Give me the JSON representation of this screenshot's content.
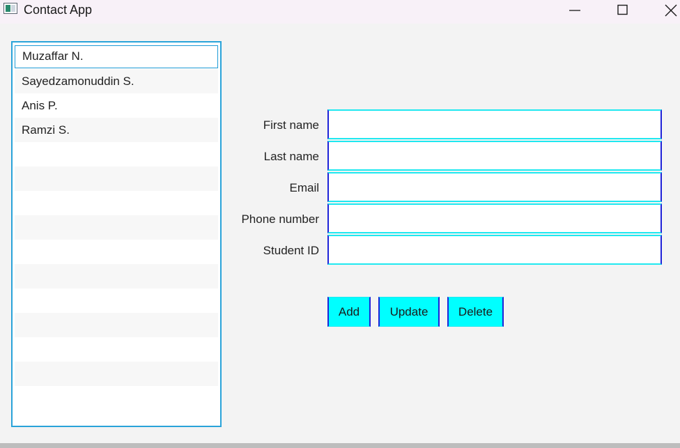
{
  "window": {
    "title": "Contact App",
    "icon": "app-window-icon",
    "controls": [
      "minimize-icon",
      "maximize-icon",
      "close-icon"
    ]
  },
  "contacts": {
    "items": [
      "Muzaffar N.",
      "Sayedzamonuddin S.",
      "Anis P.",
      "Ramzi S."
    ],
    "selected_index": 0
  },
  "form": {
    "first_name": {
      "label": "First name",
      "value": ""
    },
    "last_name": {
      "label": "Last name",
      "value": ""
    },
    "email": {
      "label": "Email",
      "value": ""
    },
    "phone_number": {
      "label": "Phone number",
      "value": ""
    },
    "student_id": {
      "label": "Student ID",
      "value": ""
    }
  },
  "buttons": {
    "add": "Add",
    "update": "Update",
    "delete": "Delete"
  },
  "colors": {
    "accent_button": "#00ffff",
    "field_border_horizontal": "#20e8f0",
    "field_border_vertical": "#1e22d8",
    "list_border": "#29a3d9"
  }
}
